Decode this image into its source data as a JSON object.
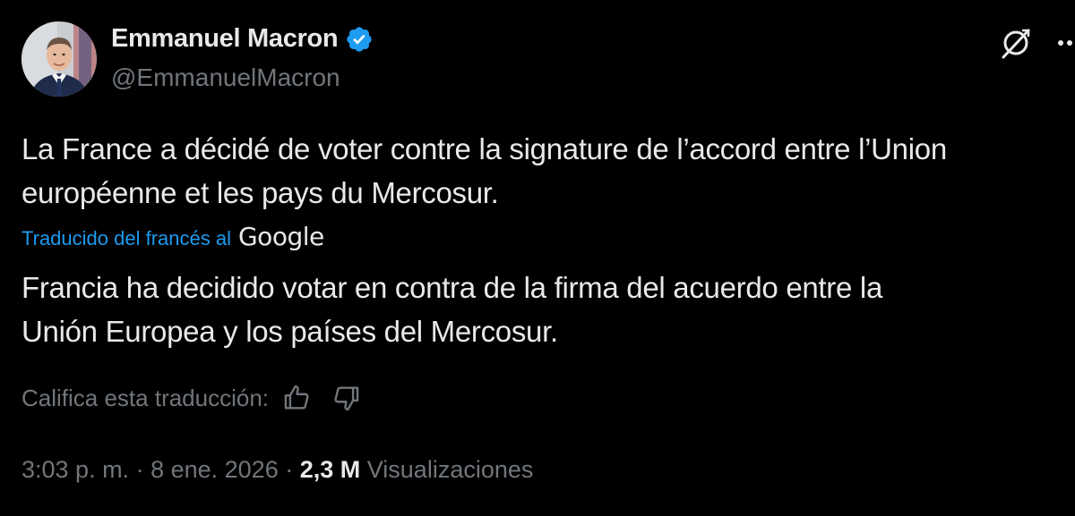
{
  "author": {
    "display_name": "Emmanuel Macron",
    "handle": "@EmmanuelMacron",
    "verified": true
  },
  "tweet": {
    "original_text": "La France a décidé de voter contre la signature de l’accord entre l’Union\neuropéenne et les pays du Mercosur.",
    "translated_from_label": "Traducido del francés al",
    "translator_logo_text": "Google",
    "translated_text": "Francia ha decidido votar en contra de la firma del acuerdo entre la\nUnión Europea y los países del Mercosur."
  },
  "translation_rating": {
    "label": "Califica esta traducción:",
    "thumbs_up_icon": "thumbs-up-icon",
    "thumbs_down_icon": "thumbs-down-icon"
  },
  "meta": {
    "time": "3:03 p. m.",
    "separator1": " · ",
    "date": "8 ene. 2026",
    "separator2": " · ",
    "views_count": "2,3 M",
    "views_label": "Visualizaciones"
  },
  "colors": {
    "background": "#000000",
    "primary_text": "#e7e9ea",
    "secondary_text": "#71767b",
    "link": "#1d9bf0",
    "verified_badge": "#1d9bf0"
  },
  "icons": {
    "verified": "verified-badge-icon",
    "grok": "grok-icon",
    "more": "more-options-icon"
  }
}
